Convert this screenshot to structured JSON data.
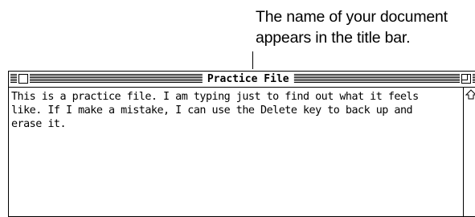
{
  "callout": {
    "line1": "The name of your document",
    "line2": "appears in the title bar."
  },
  "window": {
    "title": "Practice File",
    "content": {
      "line1": "This is a practice file.  I am typing just to find out what it feels",
      "line2": "like.  If I make a mistake, I can use the Delete key to back up and",
      "line3": "erase it."
    }
  },
  "icons": {
    "close": "close-box-icon",
    "zoom": "zoom-box-icon",
    "scroll_up": "scroll-up-arrow-icon"
  }
}
